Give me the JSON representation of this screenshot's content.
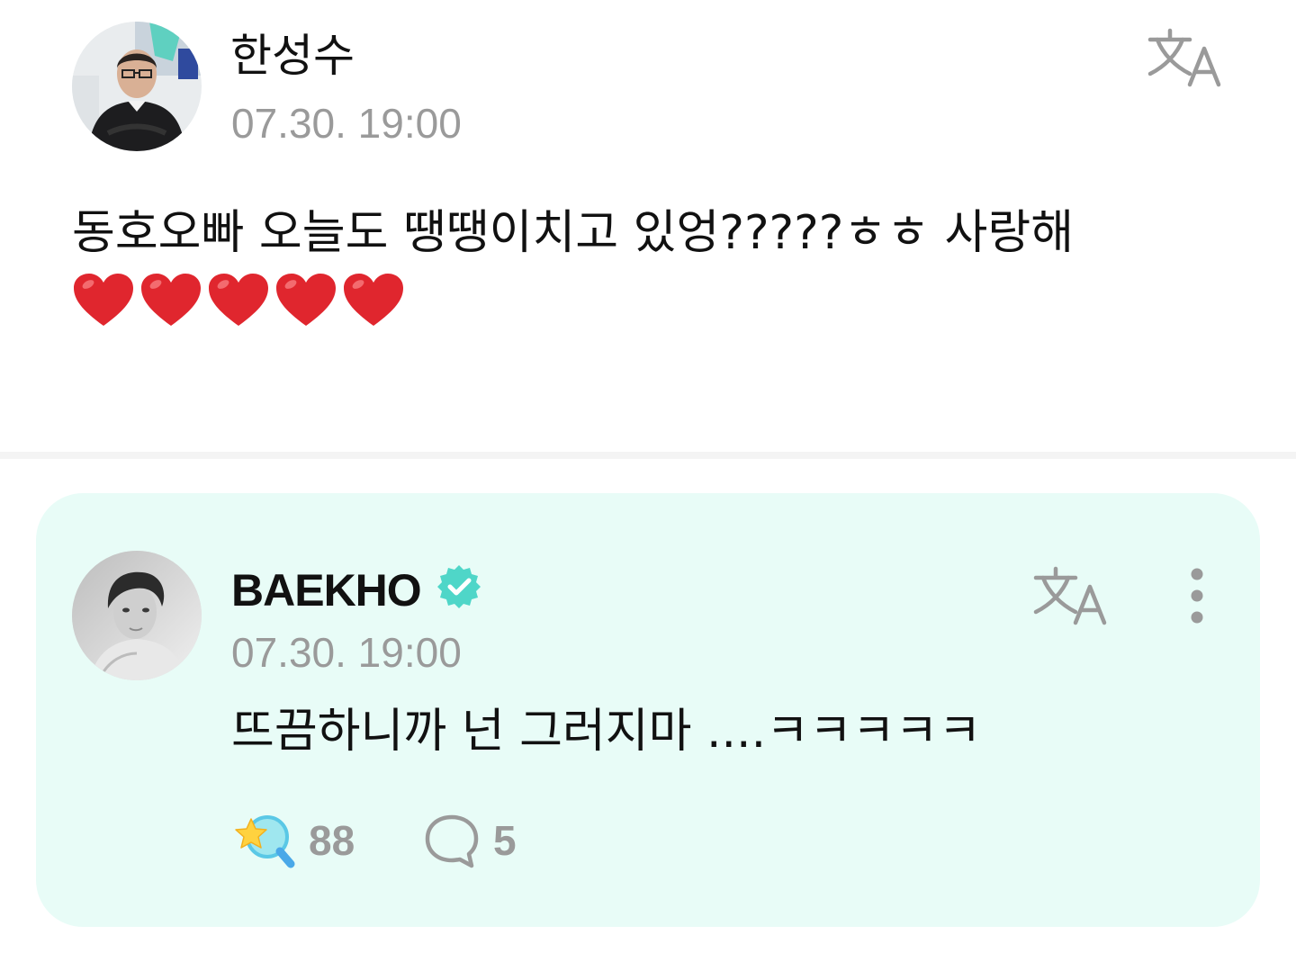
{
  "post": {
    "author": "한성수",
    "timestamp": "07.30. 19:00",
    "text": "동호오빠 오늘도 땡땡이치고 있엉?????ㅎㅎ 사랑해",
    "hearts": 5,
    "avatar_icon": "profile-photo-man-in-dark-sweater",
    "translate_icon": "translate-icon"
  },
  "reply": {
    "author": "BAEKHO",
    "verified": true,
    "timestamp": "07.30. 19:00",
    "text": "뜨끔하니까 넌 그러지마 ....ㅋㅋㅋㅋㅋ",
    "like_count": "88",
    "comment_count": "5",
    "avatar_icon": "profile-photo-monochrome-portrait",
    "like_icon": "star-search-like-icon",
    "comment_icon": "speech-bubble-icon",
    "more_icon": "more-vertical-icon"
  },
  "colors": {
    "reply_background": "#e8fcf7",
    "verified_badge": "#4fd6c8",
    "meta_text": "#9a9a9a",
    "heart": "#e0262e",
    "divider": "#f4f4f4"
  }
}
